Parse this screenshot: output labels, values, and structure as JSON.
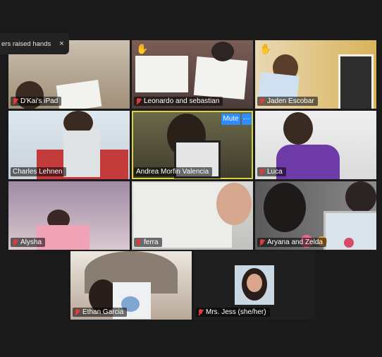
{
  "notification": {
    "text": "ers raised hands",
    "close": "×"
  },
  "controls": {
    "mute_label": "Mute",
    "more_label": "···"
  },
  "participants": [
    {
      "name": "D'Kai's iPad",
      "muted": true,
      "hand_raised": false,
      "active_speaker": false
    },
    {
      "name": "Leonardo and sebastian",
      "muted": true,
      "hand_raised": true,
      "active_speaker": false
    },
    {
      "name": "Jaden Escobar",
      "muted": true,
      "hand_raised": true,
      "active_speaker": false
    },
    {
      "name": "Charles Lehnen",
      "muted": false,
      "hand_raised": false,
      "active_speaker": false
    },
    {
      "name": "Andrea Morfin Valencia",
      "muted": false,
      "hand_raised": false,
      "active_speaker": true
    },
    {
      "name": "Luca",
      "muted": true,
      "hand_raised": false,
      "active_speaker": false
    },
    {
      "name": "Alysha",
      "muted": true,
      "hand_raised": false,
      "active_speaker": false
    },
    {
      "name": "ferra",
      "muted": true,
      "hand_raised": false,
      "active_speaker": false
    },
    {
      "name": "Aryana and Zelda",
      "muted": true,
      "hand_raised": false,
      "active_speaker": false
    },
    {
      "name": "Ethan Garcia",
      "muted": true,
      "hand_raised": false,
      "active_speaker": false
    },
    {
      "name": "Mrs. Jess (she/her)",
      "muted": true,
      "hand_raised": false,
      "active_speaker": false
    }
  ],
  "icons": {
    "hand": "raised-hand-icon",
    "mic": "mic-muted-icon"
  },
  "colors": {
    "background": "#1a1a1a",
    "active_border": "#d8d33a",
    "muted_mic": "#e23b3b",
    "button_blue": "#2d8cff"
  }
}
